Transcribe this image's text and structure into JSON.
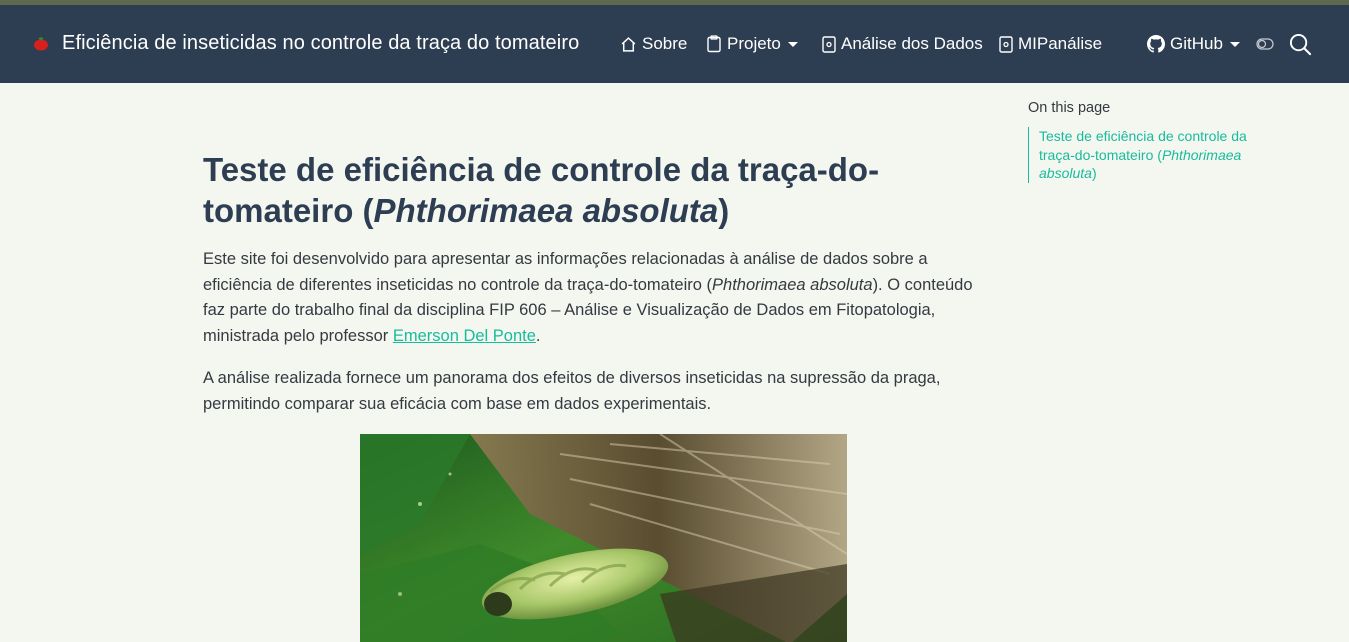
{
  "navbar": {
    "title": "Eficiência de inseticidas no controle da traça do tomateiro",
    "items": [
      {
        "label": "Sobre",
        "icon": "house-icon"
      },
      {
        "label": "Projeto",
        "icon": "clipboard-icon",
        "dropdown": true
      },
      {
        "label": "Análise dos Dados",
        "icon": "file-code-icon"
      },
      {
        "label": "MIPanálise",
        "icon": "file-code-icon"
      }
    ],
    "github": {
      "label": "GitHub",
      "icon": "github-icon",
      "dropdown": true
    },
    "toggle_icon": "toggle-icon",
    "search_icon": "search-icon",
    "colors": {
      "bg": "#2e3e52",
      "accent": "#18bc9c"
    }
  },
  "main": {
    "title_part1": "Teste de eficiência de controle da traça-do-tomateiro (",
    "title_italic": "Phthorimaea absoluta",
    "title_part2": ")",
    "p1_part1": "Este site foi desenvolvido para apresentar as informações relacionadas à análise de dados sobre a eficiência de diferentes inseticidas no controle da traça-do-tomateiro (",
    "p1_italic": "Phthorimaea absoluta",
    "p1_part2": "). O conteúdo faz parte do trabalho final da disciplina FIP 606 – Análise e Visualização de Dados em Fitopatologia, ministrada pelo professor ",
    "p1_link": "Emerson Del Ponte",
    "p1_part3": ".",
    "p2": "A análise realizada fornece um panorama dos efeitos de diversos inseticidas na supressão da praga, permitindo comparar sua eficácia com base em dados experimentais."
  },
  "toc": {
    "title": "On this page",
    "link_part1": "Teste de eficiência de controle da traça-do-tomateiro (",
    "link_italic": "Phthorimaea absoluta",
    "link_part2": ")"
  }
}
